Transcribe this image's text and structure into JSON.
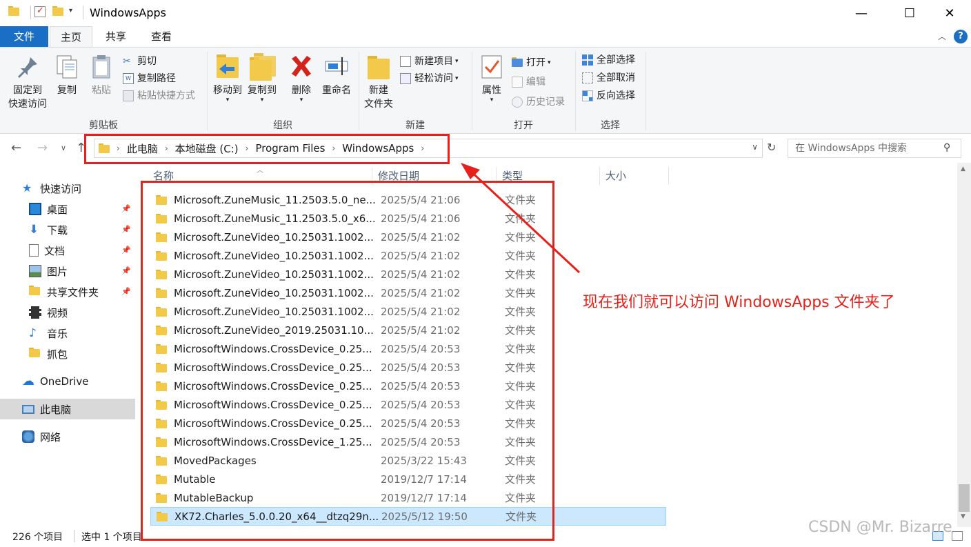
{
  "window": {
    "title": "WindowsApps",
    "controls": {
      "minimize": "—",
      "maximize": "☐",
      "close": "✕"
    }
  },
  "menu": {
    "file": "文件",
    "home": "主页",
    "share": "共享",
    "view": "查看"
  },
  "ribbon": {
    "clipboard": {
      "pin_quick_access_line1": "固定到",
      "pin_quick_access_line2": "快速访问",
      "copy": "复制",
      "paste": "粘贴",
      "cut": "剪切",
      "copy_path": "复制路径",
      "paste_shortcut": "粘贴快捷方式",
      "group_label": "剪贴板"
    },
    "organize": {
      "move_to": "移动到",
      "copy_to": "复制到",
      "delete": "删除",
      "rename": "重命名",
      "group_label": "组织"
    },
    "new": {
      "new_folder_line1": "新建",
      "new_folder_line2": "文件夹",
      "new_item": "新建项目",
      "easy_access": "轻松访问",
      "group_label": "新建"
    },
    "open": {
      "properties": "属性",
      "open": "打开",
      "edit": "编辑",
      "history": "历史记录",
      "group_label": "打开"
    },
    "select": {
      "select_all": "全部选择",
      "select_none": "全部取消",
      "invert_selection": "反向选择",
      "group_label": "选择"
    }
  },
  "address": {
    "crumbs": [
      "此电脑",
      "本地磁盘 (C:)",
      "Program Files",
      "WindowsApps"
    ],
    "search_placeholder": "在 WindowsApps 中搜索"
  },
  "sidebar": {
    "items": [
      {
        "label": "快速访问",
        "icon": "star-icon"
      },
      {
        "label": "桌面",
        "icon": "desktop-icon"
      },
      {
        "label": "下载",
        "icon": "download-icon"
      },
      {
        "label": "文档",
        "icon": "document-icon"
      },
      {
        "label": "图片",
        "icon": "picture-icon"
      },
      {
        "label": "共享文件夹",
        "icon": "folder-icon"
      },
      {
        "label": "视频",
        "icon": "video-icon"
      },
      {
        "label": "音乐",
        "icon": "music-icon"
      },
      {
        "label": "抓包",
        "icon": "folder-icon"
      },
      {
        "label": "OneDrive",
        "icon": "cloud-icon"
      },
      {
        "label": "此电脑",
        "icon": "computer-icon"
      },
      {
        "label": "网络",
        "icon": "network-icon"
      }
    ]
  },
  "columns": {
    "name": "名称",
    "date": "修改日期",
    "type": "类型",
    "size": "大小"
  },
  "files": [
    {
      "name": "Microsoft.ZuneMusic_11.2503.5.0_ne...",
      "date": "2025/5/4 21:06",
      "type": "文件夹"
    },
    {
      "name": "Microsoft.ZuneMusic_11.2503.5.0_x6...",
      "date": "2025/5/4 21:06",
      "type": "文件夹"
    },
    {
      "name": "Microsoft.ZuneVideo_10.25031.1002...",
      "date": "2025/5/4 21:02",
      "type": "文件夹"
    },
    {
      "name": "Microsoft.ZuneVideo_10.25031.1002...",
      "date": "2025/5/4 21:02",
      "type": "文件夹"
    },
    {
      "name": "Microsoft.ZuneVideo_10.25031.1002...",
      "date": "2025/5/4 21:02",
      "type": "文件夹"
    },
    {
      "name": "Microsoft.ZuneVideo_10.25031.1002...",
      "date": "2025/5/4 21:02",
      "type": "文件夹"
    },
    {
      "name": "Microsoft.ZuneVideo_10.25031.1002...",
      "date": "2025/5/4 21:02",
      "type": "文件夹"
    },
    {
      "name": "Microsoft.ZuneVideo_2019.25031.10...",
      "date": "2025/5/4 21:02",
      "type": "文件夹"
    },
    {
      "name": "MicrosoftWindows.CrossDevice_0.25...",
      "date": "2025/5/4 20:53",
      "type": "文件夹"
    },
    {
      "name": "MicrosoftWindows.CrossDevice_0.25...",
      "date": "2025/5/4 20:53",
      "type": "文件夹"
    },
    {
      "name": "MicrosoftWindows.CrossDevice_0.25...",
      "date": "2025/5/4 20:53",
      "type": "文件夹"
    },
    {
      "name": "MicrosoftWindows.CrossDevice_0.25...",
      "date": "2025/5/4 20:53",
      "type": "文件夹"
    },
    {
      "name": "MicrosoftWindows.CrossDevice_0.25...",
      "date": "2025/5/4 20:53",
      "type": "文件夹"
    },
    {
      "name": "MicrosoftWindows.CrossDevice_1.25...",
      "date": "2025/5/4 20:53",
      "type": "文件夹"
    },
    {
      "name": "MovedPackages",
      "date": "2025/3/22 15:43",
      "type": "文件夹"
    },
    {
      "name": "Mutable",
      "date": "2019/12/7 17:14",
      "type": "文件夹"
    },
    {
      "name": "MutableBackup",
      "date": "2019/12/7 17:14",
      "type": "文件夹"
    },
    {
      "name": "XK72.Charles_5.0.0.20_x64__dtzq29n...",
      "date": "2025/5/12 19:50",
      "type": "文件夹"
    }
  ],
  "status": {
    "count": "226 个项目",
    "selected": "选中 1 个项目"
  },
  "annotation": {
    "text": "现在我们就可以访问 WindowsApps 文件夹了"
  },
  "watermark": "CSDN @Mr. Bizarre",
  "colors": {
    "accent": "#1a6fc4",
    "annotation_red": "#e8201a",
    "selection": "#cce8ff",
    "folder": "#f3c94a"
  }
}
